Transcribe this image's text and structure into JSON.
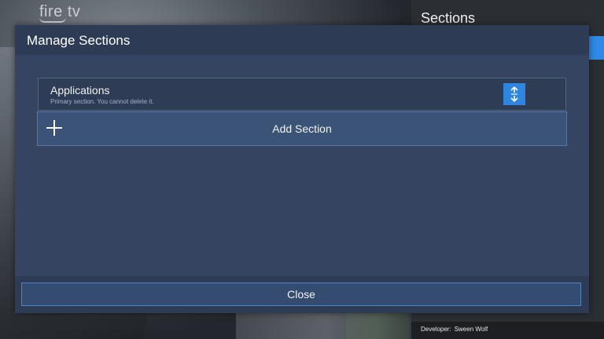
{
  "background": {
    "brand_logo_text": "fire tv"
  },
  "side_panel": {
    "title": "Sections",
    "footer": {
      "developer_label": "Developer:",
      "developer_name": "Sween Wolf"
    }
  },
  "dialog": {
    "title": "Manage Sections",
    "sections": [
      {
        "name": "Applications",
        "description": "Primary section. You cannot delete it.",
        "action_icon": "reorder-arrows-icon"
      }
    ],
    "add_section_label": "Add Section",
    "add_section_icon": "plus-icon",
    "close_label": "Close"
  },
  "colors": {
    "accent": "#2f86e0",
    "dialog_bg": "#344461",
    "dialog_header": "#2d3b54"
  }
}
